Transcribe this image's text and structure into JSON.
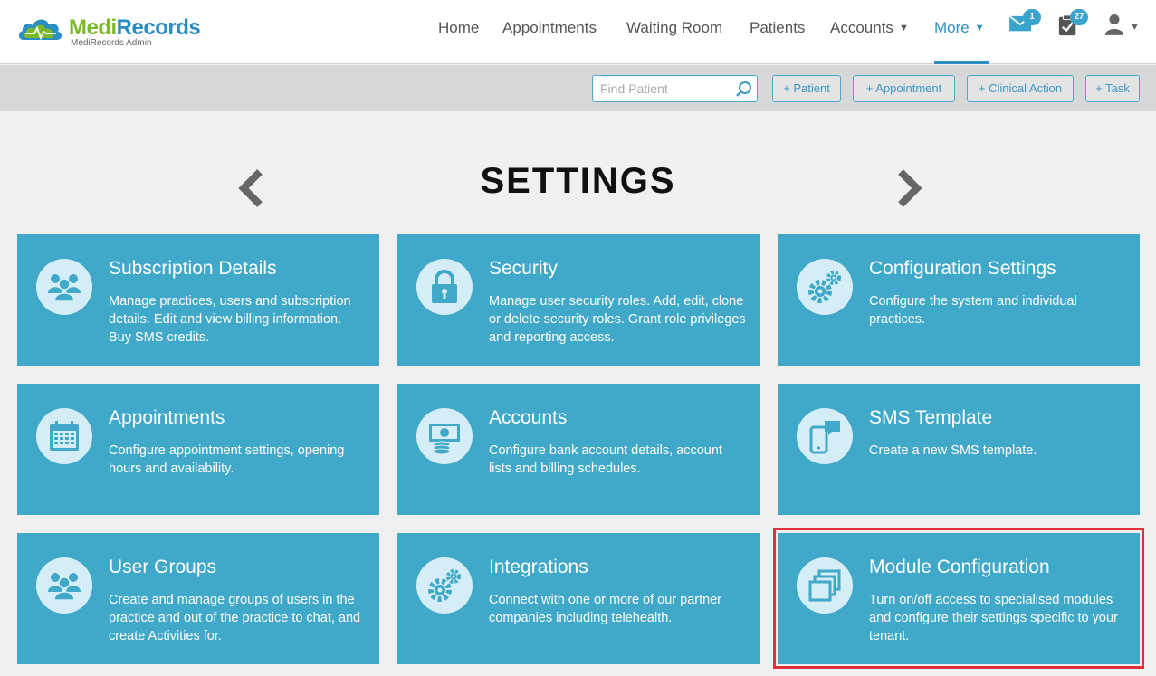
{
  "logo": {
    "brand_part1": "Medi",
    "brand_part2": "Records",
    "subtitle": "MediRecords Admin"
  },
  "nav": {
    "home": "Home",
    "appointments": "Appointments",
    "waiting_room": "Waiting Room",
    "patients": "Patients",
    "accounts": "Accounts",
    "more": "More"
  },
  "header_icons": {
    "messages_badge": "1",
    "tasks_badge": "27",
    "user": "user-icon"
  },
  "toolbar": {
    "search_placeholder": "Find Patient",
    "add_patient": "+ Patient",
    "add_appointment": "+ Appointment",
    "add_clinical_action": "+ Clinical Action",
    "add_task": "+ Task"
  },
  "page": {
    "title": "SETTINGS"
  },
  "cards": [
    {
      "title": "Subscription Details",
      "desc": "Manage practices, users and subscription details. Edit and view billing information. Buy SMS credits.",
      "icon": "users-icon"
    },
    {
      "title": "Security",
      "desc": "Manage user security roles. Add, edit, clone or delete security roles. Grant role privileges and reporting access.",
      "icon": "lock-icon"
    },
    {
      "title": "Configuration Settings",
      "desc": "Configure the system and individual practices.",
      "icon": "gears-icon"
    },
    {
      "title": "Appointments",
      "desc": "Configure appointment settings, opening hours and availability.",
      "icon": "calendar-icon"
    },
    {
      "title": "Accounts",
      "desc": "Configure bank account details, account lists and billing schedules.",
      "icon": "money-icon"
    },
    {
      "title": "SMS Template",
      "desc": "Create a new SMS template.",
      "icon": "phone-message-icon"
    },
    {
      "title": "User Groups",
      "desc": "Create and manage groups of users in the practice and out of the practice to chat, and create Activities for.",
      "icon": "users-icon"
    },
    {
      "title": "Integrations",
      "desc": "Connect with one or more of our partner companies including telehealth.",
      "icon": "gears-icon"
    },
    {
      "title": "Module Configuration",
      "desc": "Turn on/off access to specialised modules and configure their settings specific to your tenant.",
      "icon": "stacked-windows-icon"
    }
  ],
  "colors": {
    "card": "#40a8c8",
    "accent": "#2d8fc4",
    "highlight": "#e0313b"
  }
}
